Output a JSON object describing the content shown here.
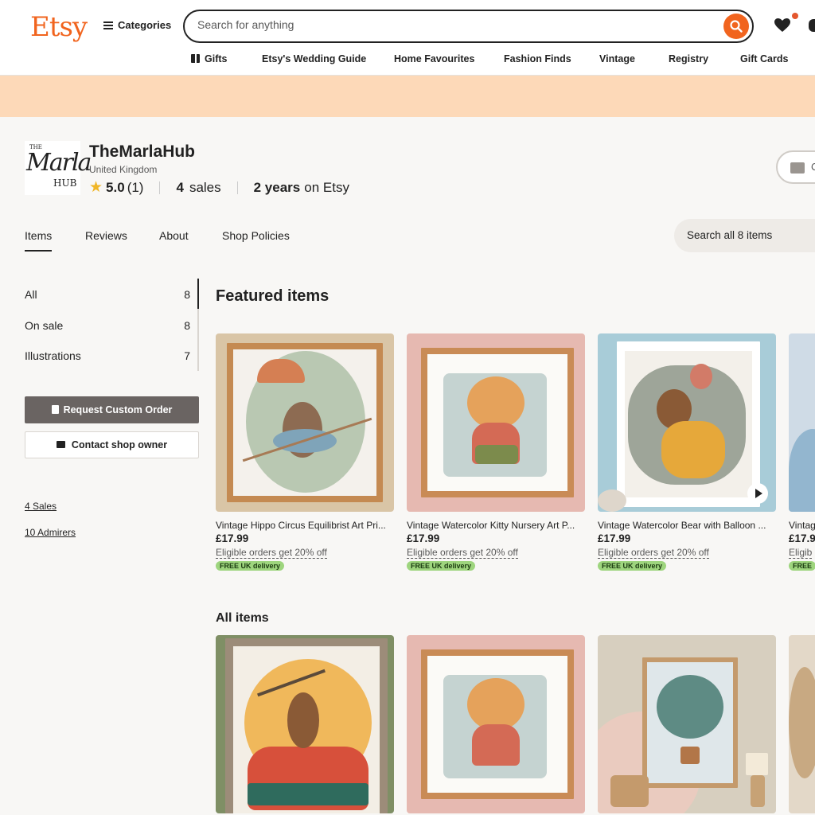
{
  "header": {
    "logo": "Etsy",
    "categories_label": "Categories",
    "search_placeholder": "Search for anything",
    "nav": [
      "Gifts",
      "Etsy's Wedding Guide",
      "Home Favourites",
      "Fashion Finds",
      "Vintage",
      "Registry",
      "Gift Cards"
    ]
  },
  "shop": {
    "logo_top": "THE",
    "logo_main": "Marla",
    "logo_bottom": "HUB",
    "name": "TheMarlaHub",
    "location": "United Kingdom",
    "rating": "5.0",
    "rating_count": "(1)",
    "sales_num": "4",
    "sales_label": "sales",
    "years": "2 years",
    "years_suffix": "on Etsy",
    "message_label": "C"
  },
  "tabs": [
    "Items",
    "Reviews",
    "About",
    "Shop Policies"
  ],
  "shop_search_placeholder": "Search all 8 items",
  "sidebar": {
    "sections": [
      {
        "label": "All",
        "count": "8"
      },
      {
        "label": "On sale",
        "count": "8"
      },
      {
        "label": "Illustrations",
        "count": "7"
      }
    ],
    "request_custom_label": "Request Custom Order",
    "contact_label": "Contact shop owner",
    "sales_link": "4 Sales",
    "admirers_link": "10 Admirers"
  },
  "featured": {
    "title": "Featured items",
    "items": [
      {
        "title": "Vintage Hippo Circus Equilibrist Art Pri...",
        "price": "£17.99",
        "promo": "Eligible orders get 20% off",
        "badge": "FREE UK delivery"
      },
      {
        "title": "Vintage Watercolor Kitty Nursery Art P...",
        "price": "£17.99",
        "promo": "Eligible orders get 20% off",
        "badge": "FREE UK delivery"
      },
      {
        "title": "Vintage Watercolor Bear with Balloon ...",
        "price": "£17.99",
        "promo": "Eligible orders get 20% off",
        "badge": "FREE UK delivery"
      },
      {
        "title": "Vintag",
        "price": "£17.9",
        "promo": "Eligib",
        "badge": "FREE"
      }
    ]
  },
  "all_items": {
    "title": "All items"
  },
  "colors": {
    "brand": "#f1641e",
    "banner": "#fdd9b8",
    "badge": "#9ed57e"
  }
}
